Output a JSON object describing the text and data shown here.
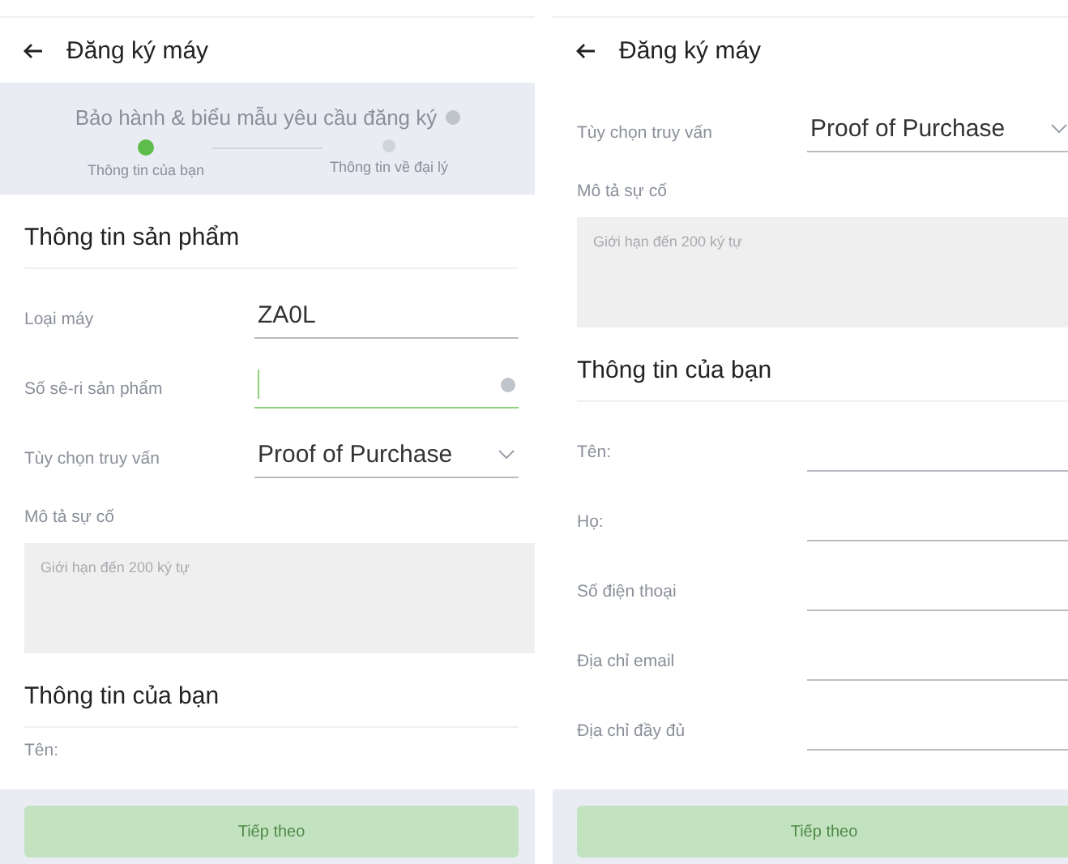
{
  "screens": [
    {
      "title": "Đăng ký máy",
      "stepper": {
        "title": "Bảo hành & biểu mẫu yêu cầu đăng ký",
        "steps": [
          {
            "label": "Thông tin của bạn",
            "selected": true
          },
          {
            "label": "Thông tin về đại lý",
            "selected": false
          }
        ]
      },
      "items": [
        {
          "kind": "heading",
          "text": "Thông tin sản phẩm"
        },
        {
          "kind": "text",
          "label": "Loại máy",
          "value": "ZA0L",
          "focused": false,
          "help": false
        },
        {
          "kind": "text",
          "label": "Số sê-ri sản phẩm",
          "value": "",
          "focused": true,
          "help": true
        },
        {
          "kind": "select",
          "label": "Tùy chọn truy vấn",
          "value": "Proof of Purchase"
        },
        {
          "kind": "textarea",
          "label": "Mô tả sự cố",
          "placeholder": "Giới hạn đến 200 ký tự"
        },
        {
          "kind": "heading",
          "text": "Thông tin của bạn"
        },
        {
          "kind": "label",
          "label": "Tên:"
        }
      ],
      "button": {
        "label": "Tiếp theo",
        "disabled": true
      }
    },
    {
      "title": "Đăng ký máy",
      "items": [
        {
          "kind": "select",
          "label": "Tùy chọn truy vấn",
          "value": "Proof of Purchase"
        },
        {
          "kind": "textarea",
          "label": "Mô tả sự cố",
          "placeholder": "Giới hạn đến 200 ký tự"
        },
        {
          "kind": "heading",
          "text": "Thông tin của bạn"
        },
        {
          "kind": "text",
          "label": "Tên:",
          "value": "",
          "focused": false,
          "help": false
        },
        {
          "kind": "text",
          "label": "Họ:",
          "value": "",
          "focused": false,
          "help": false
        },
        {
          "kind": "text",
          "label": "Số điện thoại",
          "value": "",
          "focused": false,
          "help": false
        },
        {
          "kind": "text",
          "label": "Địa chỉ email",
          "value": "",
          "focused": false,
          "help": false
        },
        {
          "kind": "text",
          "label": "Địa chỉ đầy đủ",
          "value": "",
          "focused": false,
          "help": false
        }
      ],
      "button": {
        "label": "Tiếp theo",
        "disabled": true
      }
    }
  ]
}
